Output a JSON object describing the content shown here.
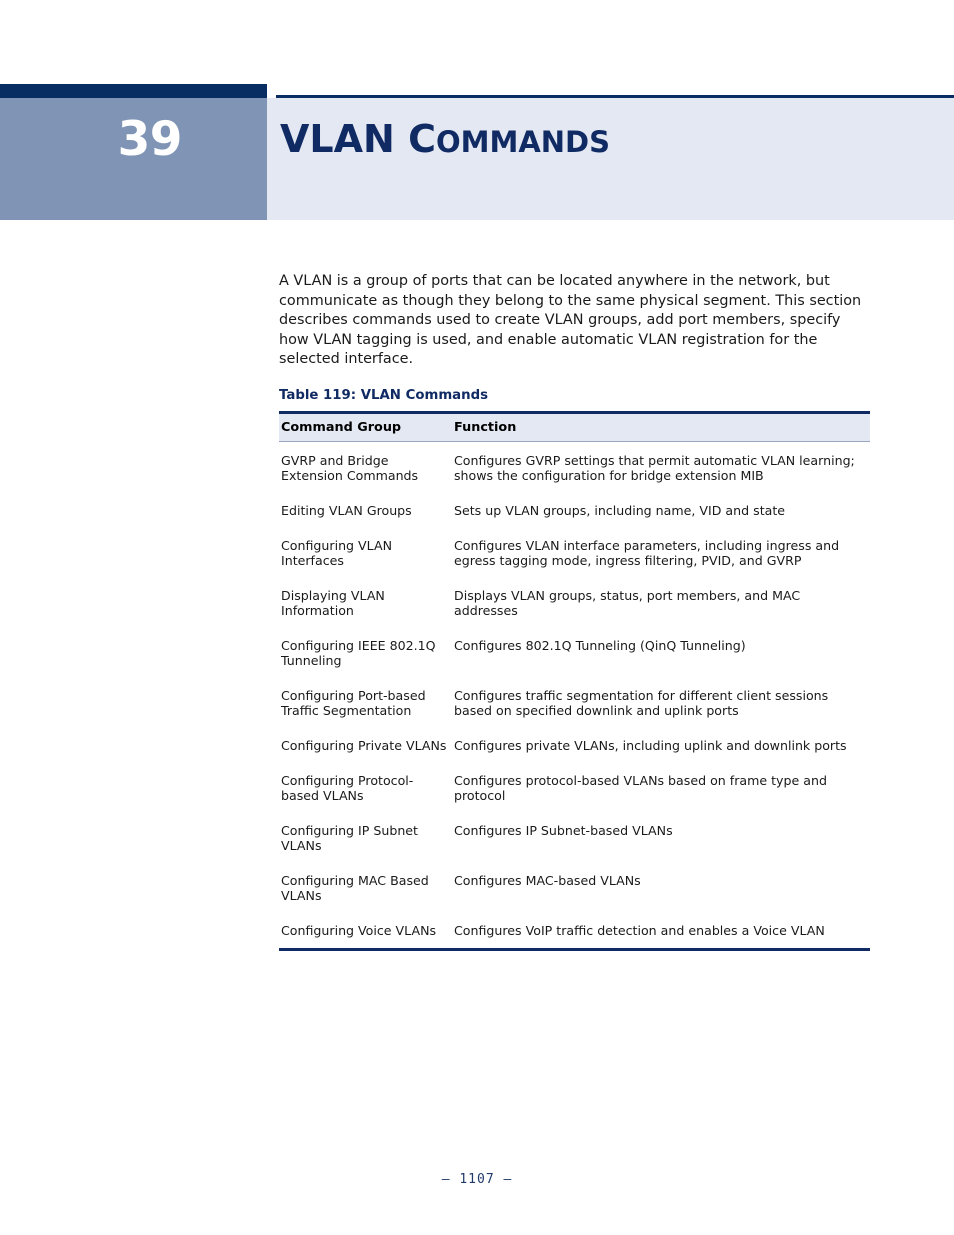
{
  "chapter": {
    "number": "39",
    "title_lead": "VLAN C",
    "title_rest": "OMMANDS",
    "title_plain": "VLAN Commands"
  },
  "intro": {
    "paragraph": "A VLAN is a group of ports that can be located anywhere in the network, but communicate as though they belong to the same physical segment. This section describes commands used to create VLAN groups, add port members, specify how VLAN tagging is used, and enable automatic VLAN registration for the selected interface."
  },
  "table": {
    "caption": "Table 119: VLAN Commands",
    "columns": [
      "Command Group",
      "Function"
    ],
    "rows": [
      {
        "group": "GVRP and Bridge Extension Commands",
        "function": "Configures GVRP settings that permit automatic VLAN learning; shows the configuration for bridge extension MIB"
      },
      {
        "group": "Editing VLAN Groups",
        "function": "Sets up VLAN groups, including name, VID and state"
      },
      {
        "group": "Configuring VLAN Interfaces",
        "function": "Configures VLAN interface parameters, including ingress and egress tagging mode, ingress filtering, PVID, and GVRP"
      },
      {
        "group": "Displaying VLAN Information",
        "function": "Displays VLAN groups, status, port members, and MAC addresses"
      },
      {
        "group": "Configuring IEEE 802.1Q Tunneling",
        "function": "Configures 802.1Q Tunneling (QinQ Tunneling)"
      },
      {
        "group": "Configuring Port-based Traffic Segmentation",
        "function": "Configures traffic segmentation for different client sessions based on specified downlink and uplink ports"
      },
      {
        "group": "Configuring Private VLANs",
        "function": "Configures private VLANs, including uplink and downlink ports"
      },
      {
        "group": "Configuring Protocol-based VLANs",
        "function": "Configures protocol-based VLANs based on frame type and protocol"
      },
      {
        "group": "Configuring IP Subnet VLANs",
        "function": "Configures IP Subnet-based VLANs"
      },
      {
        "group": "Configuring MAC Based VLANs",
        "function": "Configures MAC-based VLANs"
      },
      {
        "group": "Configuring Voice VLANs",
        "function": "Configures VoIP traffic detection and enables a Voice VLAN"
      }
    ]
  },
  "footer": {
    "page_number": "–  1107  –"
  },
  "colors": {
    "navy": "#072d63",
    "title_navy": "#102a63",
    "slate": "#8095b5",
    "lavender": "#e4e8f2",
    "link_blue": "#3232cc",
    "body_text": "#1a1a1a"
  }
}
